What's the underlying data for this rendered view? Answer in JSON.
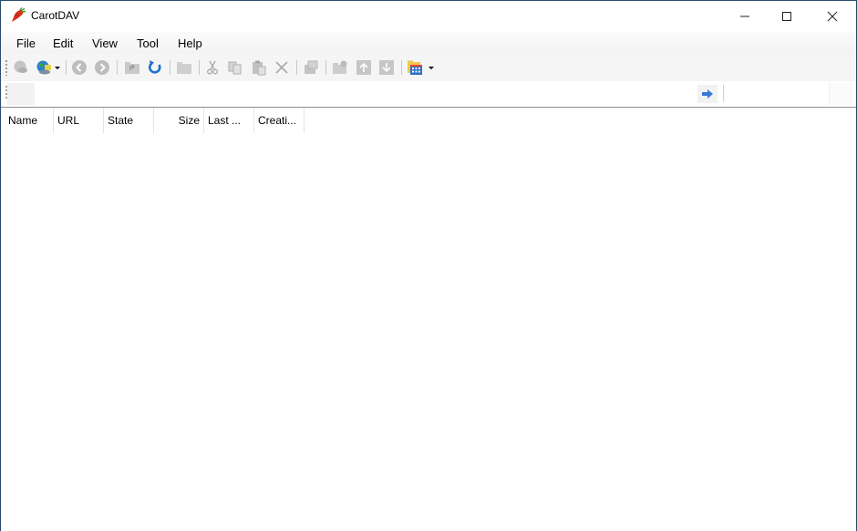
{
  "window": {
    "title": "CarotDAV",
    "app_icon": "carrot-icon",
    "controls": [
      "minimize",
      "maximize",
      "close"
    ]
  },
  "menubar": {
    "items": [
      {
        "label": "File"
      },
      {
        "label": "Edit"
      },
      {
        "label": "View"
      },
      {
        "label": "Tool"
      },
      {
        "label": "Help"
      }
    ]
  },
  "toolbar": {
    "buttons": [
      {
        "icon": "disconnect-icon",
        "enabled": false
      },
      {
        "icon": "connect-globe-icon",
        "enabled": true,
        "dropdown": true
      },
      {
        "icon": "back-icon",
        "enabled": false
      },
      {
        "icon": "forward-icon",
        "enabled": false
      },
      {
        "icon": "up-folder-icon",
        "enabled": false
      },
      {
        "icon": "refresh-icon",
        "enabled": true
      },
      {
        "icon": "new-folder-icon",
        "enabled": false
      },
      {
        "icon": "cut-icon",
        "enabled": false
      },
      {
        "icon": "copy-icon",
        "enabled": false
      },
      {
        "icon": "paste-icon",
        "enabled": false
      },
      {
        "icon": "delete-icon",
        "enabled": false
      },
      {
        "icon": "properties-icon",
        "enabled": false
      },
      {
        "icon": "folder-settings-icon",
        "enabled": false
      },
      {
        "icon": "upload-icon",
        "enabled": false
      },
      {
        "icon": "download-icon",
        "enabled": false
      },
      {
        "icon": "view-mode-icon",
        "enabled": true,
        "dropdown": true
      }
    ]
  },
  "addressbar": {
    "address_value": "",
    "go_icon": "go-arrow-icon",
    "search_value": ""
  },
  "listview": {
    "columns": [
      {
        "label": "Name"
      },
      {
        "label": "URL"
      },
      {
        "label": "State"
      },
      {
        "label": "Size"
      },
      {
        "label": "Last ..."
      },
      {
        "label": "Creati..."
      }
    ],
    "rows": []
  },
  "colors": {
    "window_border": "#2b4a6b",
    "refresh_blue": "#1f6fd1",
    "go_arrow_blue": "#3a78d8",
    "disabled_gray": "#b5b5b5"
  }
}
